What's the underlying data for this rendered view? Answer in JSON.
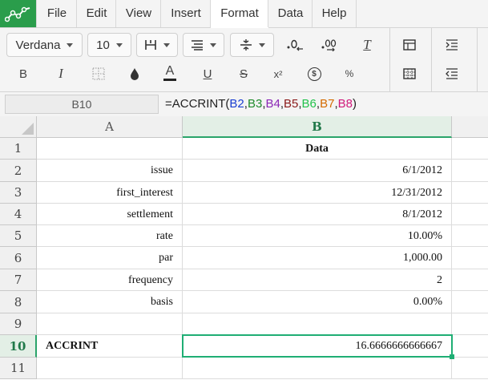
{
  "menu": [
    "File",
    "Edit",
    "View",
    "Insert",
    "Format",
    "Data",
    "Help"
  ],
  "toolbar": {
    "font": "Verdana",
    "size": "10",
    "icons": [
      "borders-icon",
      "align-icon",
      "valign-icon",
      "decrease-decimal-icon",
      "increase-decimal-icon",
      "clear-format-icon",
      "table-icon",
      "grid-icon",
      "bold-icon",
      "italic-icon",
      "border-icon",
      "fill-color-icon",
      "text-color-icon",
      "underline-icon",
      "strikethrough-icon",
      "superscript-icon",
      "currency-icon",
      "percent-icon",
      "indent-icon",
      "outdent-icon"
    ],
    "bold_label": "B",
    "italic_label": "I",
    "textcolor_label": "A",
    "underline_label": "U",
    "strike_label": "S",
    "super_label": "x²",
    "currency_label": "$",
    "percent_label": "%",
    "clear_label": "T"
  },
  "formula": {
    "namebox": "B10",
    "prefix": "=ACCRINT(",
    "args": [
      {
        "ref": "B2",
        "color": "#1a3ed1"
      },
      {
        "ref": "B3",
        "color": "#1f8a2b"
      },
      {
        "ref": "B4",
        "color": "#8b28b6"
      },
      {
        "ref": "B5",
        "color": "#8a1a1a"
      },
      {
        "ref": "B6",
        "color": "#22c24c"
      },
      {
        "ref": "B7",
        "color": "#d46a00"
      },
      {
        "ref": "B8",
        "color": "#d0197a"
      }
    ],
    "suffix": ")"
  },
  "columns": [
    "A",
    "B"
  ],
  "rows": [
    {
      "num": "1",
      "a": "",
      "b": "Data"
    },
    {
      "num": "2",
      "a": "issue",
      "b": "6/1/2012"
    },
    {
      "num": "3",
      "a": "first_interest",
      "b": "12/31/2012"
    },
    {
      "num": "4",
      "a": "settlement",
      "b": "8/1/2012"
    },
    {
      "num": "5",
      "a": "rate",
      "b": "10.00%"
    },
    {
      "num": "6",
      "a": "par",
      "b": "1,000.00"
    },
    {
      "num": "7",
      "a": "frequency",
      "b": "2"
    },
    {
      "num": "8",
      "a": "basis",
      "b": "0.00%"
    },
    {
      "num": "9",
      "a": "",
      "b": ""
    },
    {
      "num": "10",
      "a": "ACCRINT",
      "b": "16.6666666666667"
    },
    {
      "num": "11",
      "a": "",
      "b": ""
    }
  ],
  "colors": {
    "accent": "#1fae74",
    "logo": "#2a9d4b"
  }
}
